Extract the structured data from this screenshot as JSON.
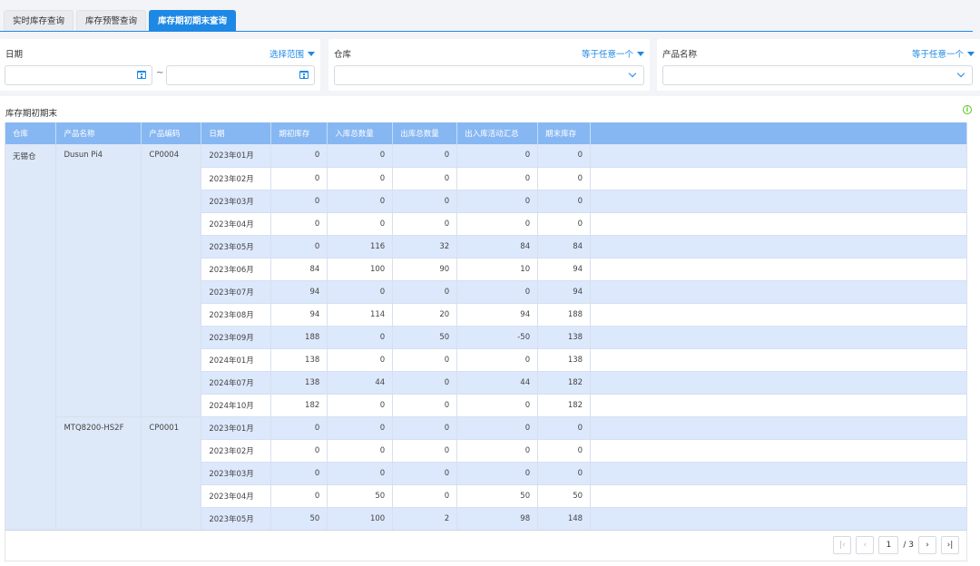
{
  "tabs": [
    {
      "label": "实时库存查询",
      "active": false
    },
    {
      "label": "库存预警查询",
      "active": false
    },
    {
      "label": "库存期初期末查询",
      "active": true
    }
  ],
  "filters": {
    "date": {
      "label": "日期",
      "op": "选择范围",
      "start": "",
      "end": "",
      "separator": "~"
    },
    "warehouse": {
      "label": "仓库",
      "op": "等于任意一个",
      "value": ""
    },
    "product": {
      "label": "产品名称",
      "op": "等于任意一个",
      "value": ""
    }
  },
  "panel": {
    "title": "库存期初期末"
  },
  "table": {
    "columns": [
      "仓库",
      "产品名称",
      "产品编码",
      "日期",
      "期初库存",
      "入库总数量",
      "出库总数量",
      "出入库活动汇总",
      "期末库存"
    ],
    "groups": [
      {
        "warehouse": "无锡仓",
        "products": [
          {
            "name": "Dusun Pi4",
            "code": "CP0004",
            "rows": [
              [
                "2023年01月",
                "0",
                "0",
                "0",
                "0",
                "0"
              ],
              [
                "2023年02月",
                "0",
                "0",
                "0",
                "0",
                "0"
              ],
              [
                "2023年03月",
                "0",
                "0",
                "0",
                "0",
                "0"
              ],
              [
                "2023年04月",
                "0",
                "0",
                "0",
                "0",
                "0"
              ],
              [
                "2023年05月",
                "0",
                "116",
                "32",
                "84",
                "84"
              ],
              [
                "2023年06月",
                "84",
                "100",
                "90",
                "10",
                "94"
              ],
              [
                "2023年07月",
                "94",
                "0",
                "0",
                "0",
                "94"
              ],
              [
                "2023年08月",
                "94",
                "114",
                "20",
                "94",
                "188"
              ],
              [
                "2023年09月",
                "188",
                "0",
                "50",
                "-50",
                "138"
              ],
              [
                "2024年01月",
                "138",
                "0",
                "0",
                "0",
                "138"
              ],
              [
                "2024年07月",
                "138",
                "44",
                "0",
                "44",
                "182"
              ],
              [
                "2024年10月",
                "182",
                "0",
                "0",
                "0",
                "182"
              ]
            ]
          },
          {
            "name": "MTQ8200-HS2F",
            "code": "CP0001",
            "rows": [
              [
                "2023年01月",
                "0",
                "0",
                "0",
                "0",
                "0"
              ],
              [
                "2023年02月",
                "0",
                "0",
                "0",
                "0",
                "0"
              ],
              [
                "2023年03月",
                "0",
                "0",
                "0",
                "0",
                "0"
              ],
              [
                "2023年04月",
                "0",
                "50",
                "0",
                "50",
                "50"
              ],
              [
                "2023年05月",
                "50",
                "100",
                "2",
                "98",
                "148"
              ]
            ]
          }
        ]
      }
    ]
  },
  "pagination": {
    "current": "1",
    "total": "/ 3"
  },
  "colors": {
    "accent": "#1e88e5",
    "header": "#86b7f2",
    "stripe": "#dce8fb"
  }
}
